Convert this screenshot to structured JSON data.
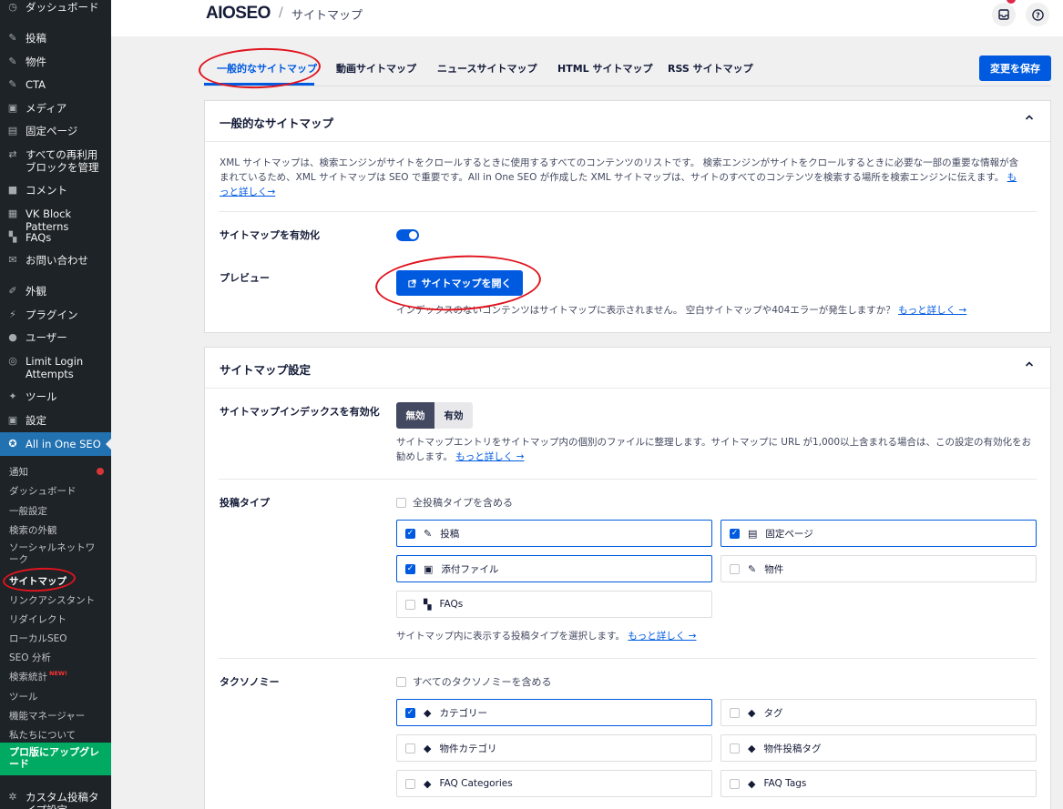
{
  "sidebar": {
    "items": [
      {
        "icon": "dashboard-icon",
        "glyph": "◷",
        "label": "ダッシュボード"
      },
      {
        "icon": "pin-icon",
        "glyph": "✎",
        "label": "投稿"
      },
      {
        "icon": "pin-icon",
        "glyph": "✎",
        "label": "物件"
      },
      {
        "icon": "pin-icon",
        "glyph": "✎",
        "label": "CTA"
      },
      {
        "icon": "media-icon",
        "glyph": "▣",
        "label": "メディア"
      },
      {
        "icon": "page-icon",
        "glyph": "▤",
        "label": "固定ページ"
      },
      {
        "icon": "reusable-block-icon",
        "glyph": "⇄",
        "label": "すべての再利用ブロックを管理"
      },
      {
        "icon": "comment-icon",
        "glyph": "■",
        "label": "コメント"
      },
      {
        "icon": "grid-icon",
        "glyph": "▦",
        "label": "VK Block Patterns"
      },
      {
        "icon": "faq-icon",
        "glyph": "▚",
        "label": "FAQs"
      },
      {
        "icon": "mail-icon",
        "glyph": "✉",
        "label": "お問い合わせ"
      },
      {
        "icon": "appearance-icon",
        "glyph": "✐",
        "label": "外観"
      },
      {
        "icon": "plugin-icon",
        "glyph": "⚡",
        "label": "プラグイン"
      },
      {
        "icon": "user-icon",
        "glyph": "●",
        "label": "ユーザー"
      },
      {
        "icon": "fingerprint-icon",
        "glyph": "◎",
        "label": "Limit Login Attempts"
      },
      {
        "icon": "wrench-icon",
        "glyph": "✦",
        "label": "ツール"
      },
      {
        "icon": "settings-icon",
        "glyph": "▣",
        "label": "設定"
      }
    ],
    "active_item": {
      "icon": "aioseo-icon",
      "glyph": "✪",
      "label": "All in One SEO"
    },
    "submenu": [
      "通知",
      "ダッシュボード",
      "一般設定",
      "検索の外観",
      "ソーシャルネットワーク",
      "サイトマップ",
      "リンクアシスタント",
      "リダイレクト",
      "ローカルSEO",
      "SEO 分析",
      "検索統計",
      "ツール",
      "機能マネージャー",
      "私たちについて"
    ],
    "new_badge": "NEW!",
    "upgrade_label": "プロ版にアップグレード",
    "bottom_item": {
      "icon": "gear-icon",
      "glyph": "✲",
      "label": "カスタム投稿タイプ設定"
    }
  },
  "header": {
    "logo": "AIOSEO",
    "separator": "/",
    "breadcrumb": "サイトマップ"
  },
  "tabs": [
    "一般的なサイトマップ",
    "動画サイトマップ",
    "ニュースサイトマップ",
    "HTML サイトマップ",
    "RSS サイトマップ"
  ],
  "save_button": "変更を保存",
  "general_card": {
    "title": "一般的なサイトマップ",
    "description": "XML サイトマップは、検索エンジンがサイトをクロールするときに使用するすべてのコンテンツのリストです。 検索エンジンがサイトをクロールするときに必要な一部の重要な情報が含まれているため、XML サイトマップは SEO で重要です。All in One SEO が作成した XML サイトマップは、サイトのすべてのコンテンツを検索する場所を検索エンジンに伝えます。",
    "learn_more": "もっと詳しく→",
    "enable_label": "サイトマップを有効化",
    "enabled": true,
    "preview_label": "プレビュー",
    "open_button": "サイトマップを開く",
    "preview_note": "インデックスのないコンテンツはサイトマップに表示されません。 空白サイトマップや404エラーが発生しますか？",
    "preview_link": "もっと詳しく →"
  },
  "settings_card": {
    "title": "サイトマップ設定",
    "index_label": "サイトマップインデックスを有効化",
    "index_off": "無効",
    "index_on": "有効",
    "index_desc": "サイトマップエントリをサイトマップ内の個別のファイルに整理します。サイトマップに URL が1,000以上含まれる場合は、この設定の有効化をお勧めします。",
    "index_link": "もっと詳しく →",
    "post_types_label": "投稿タイプ",
    "post_types_all": "全投稿タイプを含める",
    "post_types": [
      {
        "label": "投稿",
        "checked": true,
        "icon": "pin-icon",
        "glyph": "✎"
      },
      {
        "label": "固定ページ",
        "checked": true,
        "icon": "page-icon",
        "glyph": "▤"
      },
      {
        "label": "添付ファイル",
        "checked": true,
        "icon": "media-icon",
        "glyph": "▣"
      },
      {
        "label": "物件",
        "checked": false,
        "icon": "pin-icon",
        "glyph": "✎"
      },
      {
        "label": "FAQs",
        "checked": false,
        "icon": "faq-icon",
        "glyph": "▚"
      }
    ],
    "post_types_desc": "サイトマップ内に表示する投稿タイプを選択します。",
    "post_types_link": "もっと詳しく →",
    "taxonomies_label": "タクソノミー",
    "taxonomies_all": "すべてのタクソノミーを含める",
    "taxonomies": [
      {
        "label": "カテゴリー",
        "checked": true
      },
      {
        "label": "タグ",
        "checked": false
      },
      {
        "label": "物件カテゴリ",
        "checked": false
      },
      {
        "label": "物件投稿タグ",
        "checked": false
      },
      {
        "label": "FAQ Categories",
        "checked": false
      },
      {
        "label": "FAQ Tags",
        "checked": false
      }
    ]
  },
  "colors": {
    "accent": "#005ae0",
    "sidebar": "#1d2327",
    "annotation": "#e0141e",
    "upgrade": "#00aa63"
  }
}
